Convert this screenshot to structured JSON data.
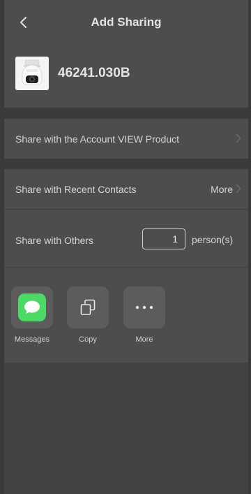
{
  "header": {
    "title": "Add Sharing",
    "back_icon": "chevron-left-icon"
  },
  "device": {
    "name": "46241.030B",
    "thumbnail_icon": "security-camera-icon"
  },
  "share_account": {
    "label": "Share with the Account VIEW Product",
    "icon": "chevron-right-icon"
  },
  "recent_contacts": {
    "label": "Share with Recent Contacts",
    "more_label": "More",
    "icon": "chevron-right-icon"
  },
  "share_others": {
    "label": "Share with Others",
    "count": "1",
    "unit": "person(s)"
  },
  "share_options": [
    {
      "label": "Messages",
      "icon": "messages-icon",
      "color": "#4cd964"
    },
    {
      "label": "Copy",
      "icon": "copy-icon"
    },
    {
      "label": "More",
      "icon": "more-dots-icon"
    }
  ],
  "colors": {
    "background": "#424242",
    "panel": "#4d4d4d",
    "separator": "#3b3b3b",
    "tile": "#5c5c5c",
    "text": "#e8e8e8"
  }
}
